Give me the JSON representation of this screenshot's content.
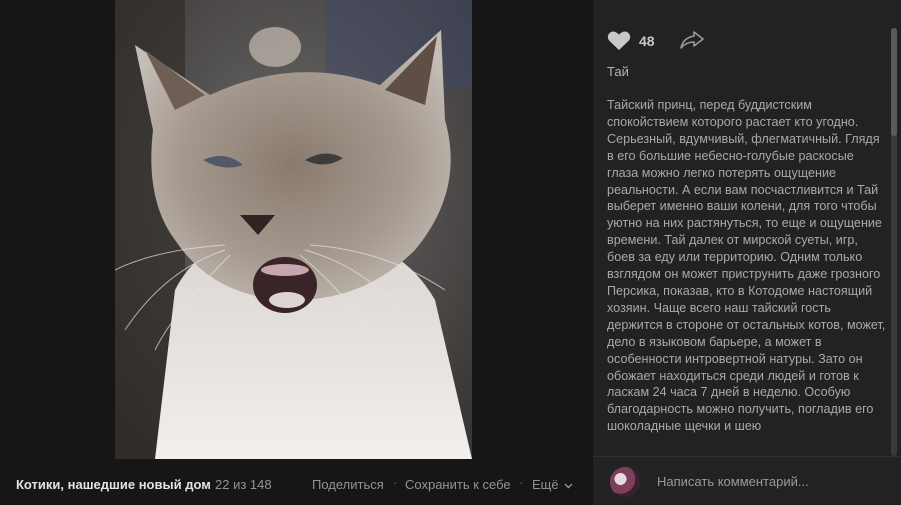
{
  "photo": {
    "alt_subject": "cat"
  },
  "bottom_bar": {
    "album_title": "Котики, нашедшие новый дом",
    "counter": "22 из 148",
    "share_label": "Поделиться",
    "save_label": "Сохранить к себе",
    "more_label": "Ещё",
    "separator": "·"
  },
  "sidebar": {
    "likes": "48",
    "name": "Тай",
    "description": "Тайский принц, перед буддистским спокойствием которого растает кто угодно. Серьезный, вдумчивый, флегматичный. Глядя в его большие небесно-голубые раскосые глаза можно легко потерять ощущение реальности. А если вам посчастливится и Тай выберет именно ваши колени, для того чтобы уютно на них растянуться, то еще и ощущение времени. Тай далек от мирской суеты, игр, боев за еду или территорию. Одним только взглядом он может приструнить даже грозного Персика, показав, кто в Котодоме настоящий хозяин. Чаще всего наш тайский гость держится в стороне от остальных котов, может, дело в языковом барьере, а может в особенности интровертной натуры. Зато он обожает находиться среди людей и готов к ласкам 24 часа 7 дней в неделю. Особую благодарность можно получить, погладив его шоколадные щечки и шею",
    "comment_placeholder": "Написать комментарий..."
  },
  "colors": {
    "like": "#c8c8c8",
    "background": "#1a1a1a",
    "panel": "#222222"
  }
}
